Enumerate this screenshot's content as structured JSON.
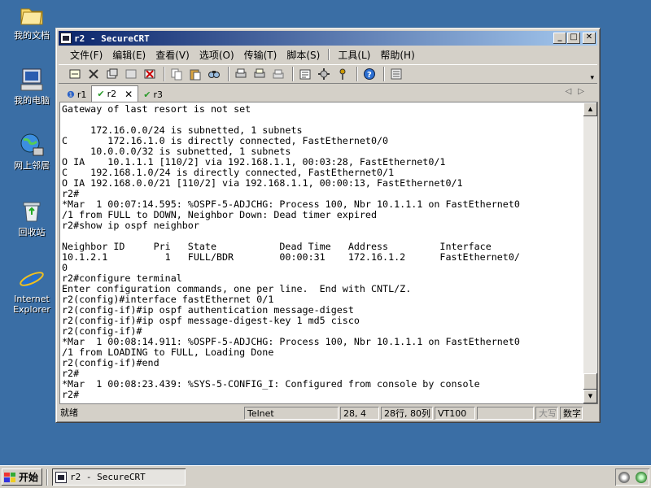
{
  "desktop": {
    "icons": [
      {
        "label": "我的文档"
      },
      {
        "label": "我的电脑"
      },
      {
        "label": "网上邻居"
      },
      {
        "label": "回收站"
      },
      {
        "label": "Internet Explorer"
      }
    ]
  },
  "window": {
    "title": "r2 - SecureCRT",
    "menu": [
      "文件(F)",
      "编辑(E)",
      "查看(V)",
      "选项(O)",
      "传输(T)",
      "脚本(S)",
      "工具(L)",
      "帮助(H)"
    ],
    "tabs": [
      {
        "label": "r1",
        "icon": "info-icon"
      },
      {
        "label": "r2",
        "icon": "check-icon",
        "active": true
      },
      {
        "label": "r3",
        "icon": "check-icon"
      }
    ],
    "terminal_lines": [
      "Gateway of last resort is not set",
      "",
      "     172.16.0.0/24 is subnetted, 1 subnets",
      "C       172.16.1.0 is directly connected, FastEthernet0/0",
      "     10.0.0.0/32 is subnetted, 1 subnets",
      "O IA    10.1.1.1 [110/2] via 192.168.1.1, 00:03:28, FastEthernet0/1",
      "C    192.168.1.0/24 is directly connected, FastEthernet0/1",
      "O IA 192.168.0.0/21 [110/2] via 192.168.1.1, 00:00:13, FastEthernet0/1",
      "r2#",
      "*Mar  1 00:07:14.595: %OSPF-5-ADJCHG: Process 100, Nbr 10.1.1.1 on FastEthernet0",
      "/1 from FULL to DOWN, Neighbor Down: Dead timer expired",
      "r2#show ip ospf neighbor",
      "",
      "Neighbor ID     Pri   State           Dead Time   Address         Interface",
      "10.1.2.1          1   FULL/BDR        00:00:31    172.16.1.2      FastEthernet0/",
      "0",
      "r2#configure terminal",
      "Enter configuration commands, one per line.  End with CNTL/Z.",
      "r2(config)#interface fastEthernet 0/1",
      "r2(config-if)#ip ospf authentication message-digest",
      "r2(config-if)#ip ospf message-digest-key 1 md5 cisco",
      "r2(config-if)#",
      "*Mar  1 00:08:14.911: %OSPF-5-ADJCHG: Process 100, Nbr 10.1.1.1 on FastEthernet0",
      "/1 from LOADING to FULL, Loading Done",
      "r2(config-if)#end",
      "r2#",
      "*Mar  1 00:08:23.439: %SYS-5-CONFIG_I: Configured from console by console",
      "r2#"
    ],
    "status": {
      "ready": "就绪",
      "protocol": "Telnet",
      "cursor": "28,  4",
      "size": "28行, 80列",
      "emulation": "VT100",
      "caps": "大写",
      "num": "数字"
    }
  },
  "taskbar": {
    "start_label": "开始",
    "task_label": "r2 - SecureCRT"
  }
}
